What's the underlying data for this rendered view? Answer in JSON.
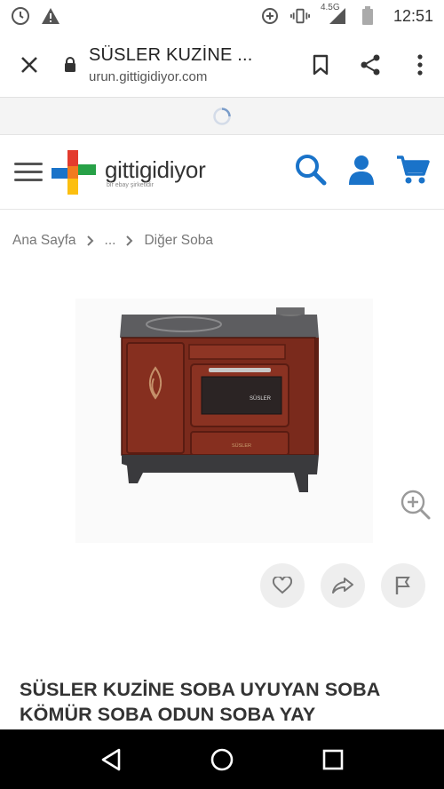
{
  "status_bar": {
    "time": "12:51",
    "network": "4.5G",
    "icons": [
      "clock-icon",
      "warning-icon",
      "data-saver-icon",
      "vibrate-icon",
      "signal-icon",
      "battery-icon"
    ]
  },
  "browser": {
    "page_title": "SÜSLER KUZİNE ...",
    "url": "urun.gittigidiyor.com",
    "icons": [
      "close-icon",
      "lock-icon",
      "bookmark-icon",
      "share-icon",
      "more-vert-icon"
    ]
  },
  "site": {
    "logo_text": "gittigidiyor",
    "logo_sub": "bir ebay şirketidir",
    "icons": [
      "menu-icon",
      "search-icon",
      "user-icon",
      "cart-icon"
    ],
    "accent_color": "#1a73c9"
  },
  "breadcrumb": {
    "items": [
      "Ana Sayfa",
      "...",
      "Diğer Soba"
    ]
  },
  "product": {
    "brand_plate": "SÜSLER",
    "drawer_plate": "SÜSLER",
    "title": "SÜSLER KUZİNE SOBA UYUYAN SOBA KÖMÜR SOBA ODUN SOBA YAY",
    "actions": [
      "favorite-icon",
      "share-arrow-icon",
      "report-flag-icon",
      "zoom-in-icon"
    ],
    "stove_color": "#7a2a1c"
  },
  "system_nav": {
    "icons": [
      "back-icon",
      "home-icon",
      "recents-icon"
    ]
  }
}
